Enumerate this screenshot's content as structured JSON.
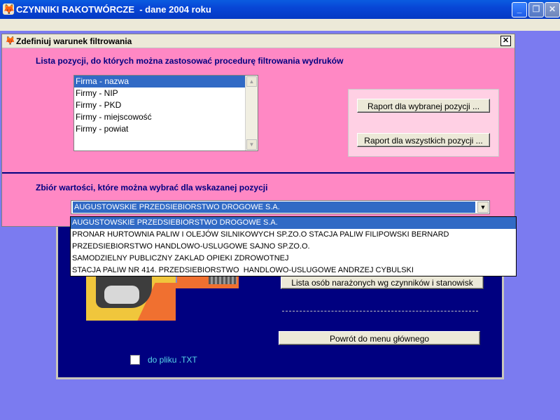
{
  "window": {
    "title": "CZYNNIKI RAKOTWÓRCZE  - dane 2004 roku",
    "icon": "fox-icon"
  },
  "report_panel": {
    "button_lista": "Lista osób narażonych wg czynników i stanowisk",
    "button_powrot": "Powrót do menu głównego",
    "checkbox_label": "do pliku .TXT",
    "checkbox_checked": false
  },
  "dialog": {
    "title": "Zdefiniuj warunek filtrowania",
    "heading_positions": "Lista pozycji, do których można zastosować procedurę filtrowania wydruków",
    "positions": [
      "Firma - nazwa",
      "Firmy - NIP",
      "Firmy - PKD",
      "Firmy - miejscowość",
      "Firmy - powiat"
    ],
    "selected_position": "Firma - nazwa",
    "button_report_selected": "Raport dla wybranej pozycji ...",
    "button_report_all": "Raport dla wszystkich pozycji ...",
    "heading_values": "Zbiór wartości, które można wybrać dla wskazanej pozycji",
    "combo_value": "AUGUSTOWSKIE PRZEDSIEBIORSTWO DROGOWE S.A.",
    "combo_options": [
      "AUGUSTOWSKIE PRZEDSIEBIORSTWO DROGOWE S.A.",
      "PRONAR HURTOWNIA PALIW I OLEJÓW SILNIKOWYCH SP.ZO.O STACJA PALIW FILIPOWSKI BERNARD",
      "PRZEDSIEBIORSTWO HANDLOWO-USLUGOWE SAJNO SP.ZO.O.",
      "SAMODZIELNY PUBLICZNY ZAKLAD OPIEKI ZDROWOTNEJ",
      "STACJA PALIW NR 414. PRZEDSIEBIORSTWO  HANDLOWO-USLUGOWE ANDRZEJ CYBULSKI"
    ]
  },
  "colors": {
    "desktop": "#7b7bf0",
    "dialog_bg": "#ff88c4",
    "heading": "#000080",
    "selection": "#316ac5",
    "panel_bg": "#000080"
  }
}
